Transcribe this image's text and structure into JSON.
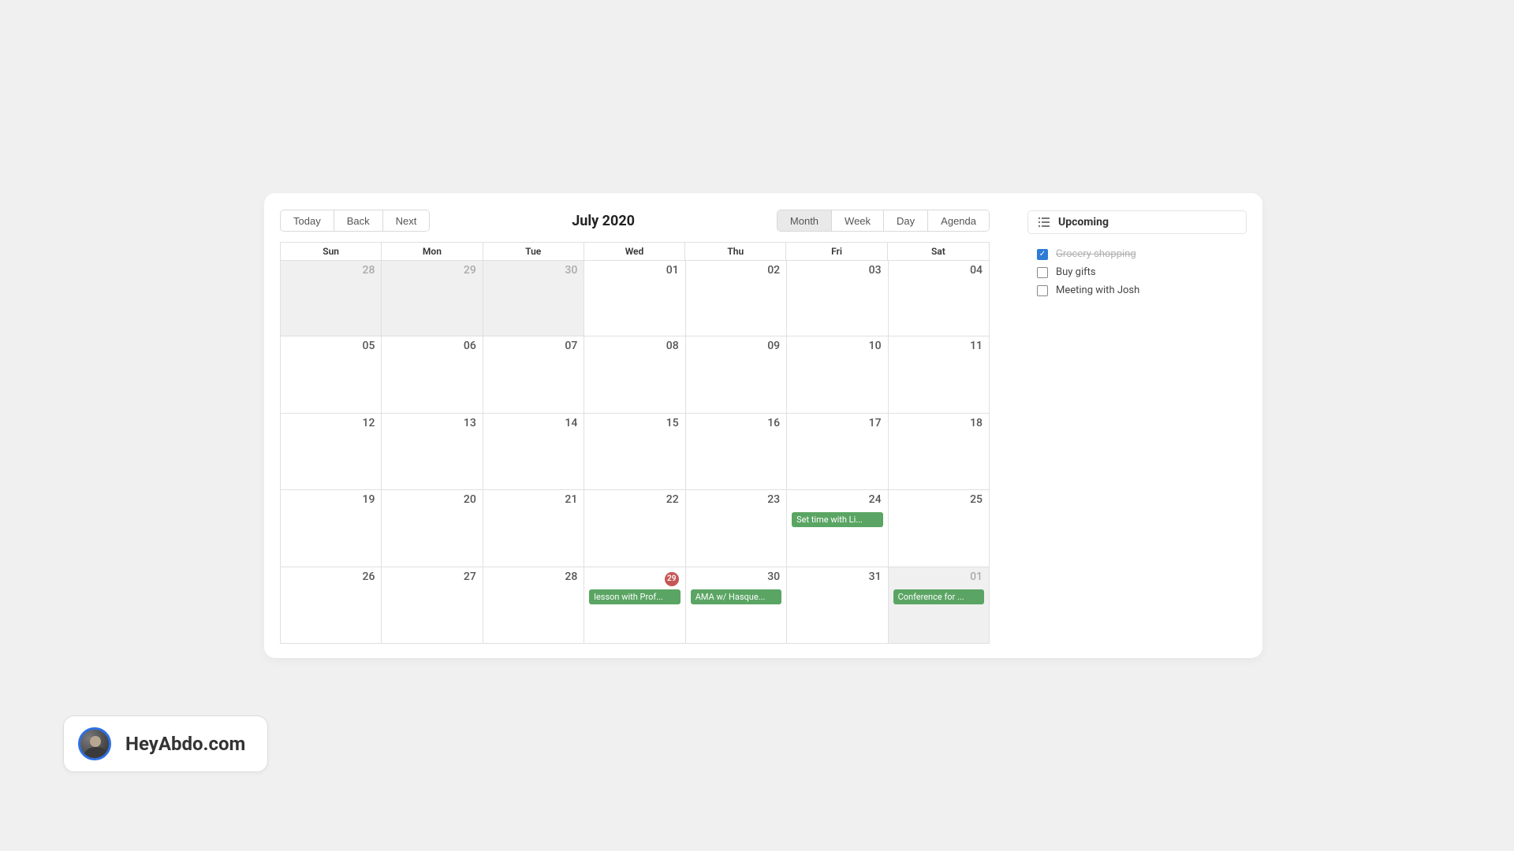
{
  "toolbar": {
    "nav": [
      "Today",
      "Back",
      "Next"
    ],
    "title": "July 2020",
    "views": [
      "Month",
      "Week",
      "Day",
      "Agenda"
    ],
    "active_view": "Month"
  },
  "dayHeaders": [
    "Sun",
    "Mon",
    "Tue",
    "Wed",
    "Thu",
    "Fri",
    "Sat"
  ],
  "cells": [
    {
      "num": "28",
      "off": true
    },
    {
      "num": "29",
      "off": true
    },
    {
      "num": "30",
      "off": true
    },
    {
      "num": "01"
    },
    {
      "num": "02"
    },
    {
      "num": "03"
    },
    {
      "num": "04"
    },
    {
      "num": "05"
    },
    {
      "num": "06"
    },
    {
      "num": "07"
    },
    {
      "num": "08"
    },
    {
      "num": "09"
    },
    {
      "num": "10"
    },
    {
      "num": "11"
    },
    {
      "num": "12"
    },
    {
      "num": "13"
    },
    {
      "num": "14"
    },
    {
      "num": "15"
    },
    {
      "num": "16"
    },
    {
      "num": "17"
    },
    {
      "num": "18"
    },
    {
      "num": "19"
    },
    {
      "num": "20"
    },
    {
      "num": "21"
    },
    {
      "num": "22"
    },
    {
      "num": "23"
    },
    {
      "num": "24",
      "event": "Set time with Li..."
    },
    {
      "num": "25"
    },
    {
      "num": "26"
    },
    {
      "num": "27"
    },
    {
      "num": "28"
    },
    {
      "num": "29",
      "today": true,
      "event": "lesson with Prof..."
    },
    {
      "num": "30",
      "event": "AMA w/ Hasque..."
    },
    {
      "num": "31"
    },
    {
      "num": "01",
      "off": true,
      "event": "Conference for ..."
    }
  ],
  "upcoming": {
    "title": "Upcoming",
    "tasks": [
      {
        "label": "Grocery shopping",
        "done": true
      },
      {
        "label": "Buy gifts",
        "done": false
      },
      {
        "label": "Meeting with Josh",
        "done": false
      }
    ]
  },
  "brand": {
    "text": "HeyAbdo.com"
  }
}
